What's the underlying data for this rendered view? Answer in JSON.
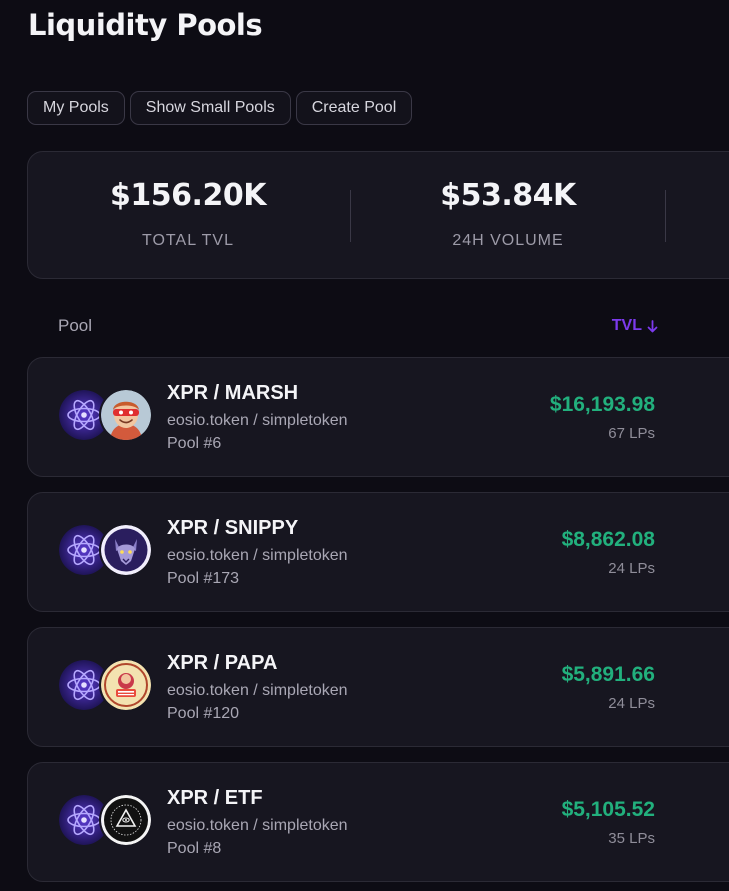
{
  "page": {
    "title": "Liquidity Pools"
  },
  "filters": [
    {
      "label": "My Pools"
    },
    {
      "label": "Show Small Pools"
    },
    {
      "label": "Create Pool"
    }
  ],
  "stats": {
    "total_tvl": {
      "value": "$156.20K",
      "label": "TOTAL TVL"
    },
    "volume_24h": {
      "value": "$53.84K",
      "label": "24H VOLUME"
    }
  },
  "list_header": {
    "pool_label": "Pool",
    "tvl_label": "TVL",
    "sort_icon": "arrow-down-icon",
    "accent_color": "#7c3aed"
  },
  "colors": {
    "tvl_value": "#22b07d",
    "background": "#0d0c14",
    "card": "#171620"
  },
  "pools": [
    {
      "pair": "XPR / MARSH",
      "contracts": "eosio.token / simpletoken",
      "pool_id": "Pool #6",
      "tvl": "$16,193.98",
      "lps": "67 LPs",
      "token_a_icon": "xpr-atom-icon",
      "token_b_icon": "marsh-avatar-icon"
    },
    {
      "pair": "XPR / SNIPPY",
      "contracts": "eosio.token / simpletoken",
      "pool_id": "Pool #173",
      "tvl": "$8,862.08",
      "lps": "24 LPs",
      "token_a_icon": "xpr-atom-icon",
      "token_b_icon": "snippy-wolf-icon"
    },
    {
      "pair": "XPR / PAPA",
      "contracts": "eosio.token / simpletoken",
      "pool_id": "Pool #120",
      "tvl": "$5,891.66",
      "lps": "24 LPs",
      "token_a_icon": "xpr-atom-icon",
      "token_b_icon": "papa-badge-icon"
    },
    {
      "pair": "XPR / ETF",
      "contracts": "eosio.token / simpletoken",
      "pool_id": "Pool #8",
      "tvl": "$5,105.52",
      "lps": "35 LPs",
      "token_a_icon": "xpr-atom-icon",
      "token_b_icon": "etf-pyramid-icon"
    }
  ]
}
